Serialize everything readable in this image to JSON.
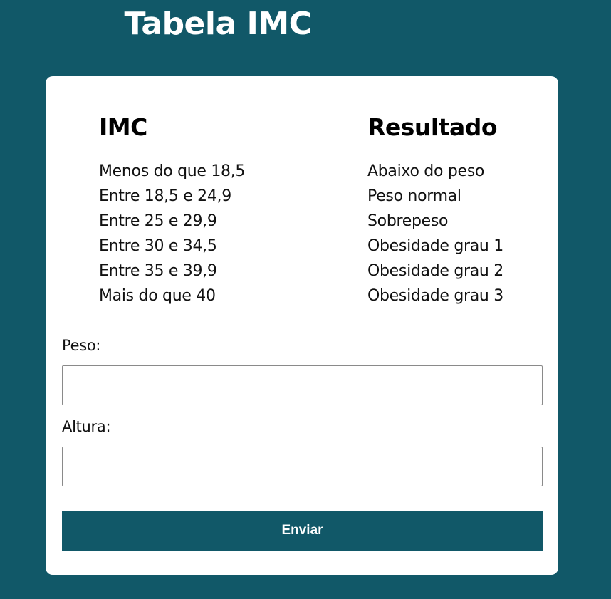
{
  "page": {
    "title": "Tabela IMC"
  },
  "table": {
    "imc_header": "IMC",
    "result_header": "Resultado",
    "rows": [
      {
        "imc": "Menos do que 18,5",
        "resultado": "Abaixo do peso"
      },
      {
        "imc": "Entre 18,5 e 24,9",
        "resultado": "Peso normal"
      },
      {
        "imc": "Entre 25 e 29,9",
        "resultado": "Sobrepeso"
      },
      {
        "imc": "Entre 30 e 34,5",
        "resultado": "Obesidade grau 1"
      },
      {
        "imc": "Entre 35 e 39,9",
        "resultado": "Obesidade grau 2"
      },
      {
        "imc": "Mais do que 40",
        "resultado": "Obesidade grau 3"
      }
    ]
  },
  "form": {
    "peso_label": "Peso:",
    "peso_value": "",
    "altura_label": "Altura:",
    "altura_value": "",
    "submit_label": "Enviar"
  },
  "colors": {
    "background": "#115868",
    "card": "#ffffff",
    "button": "#115868"
  }
}
